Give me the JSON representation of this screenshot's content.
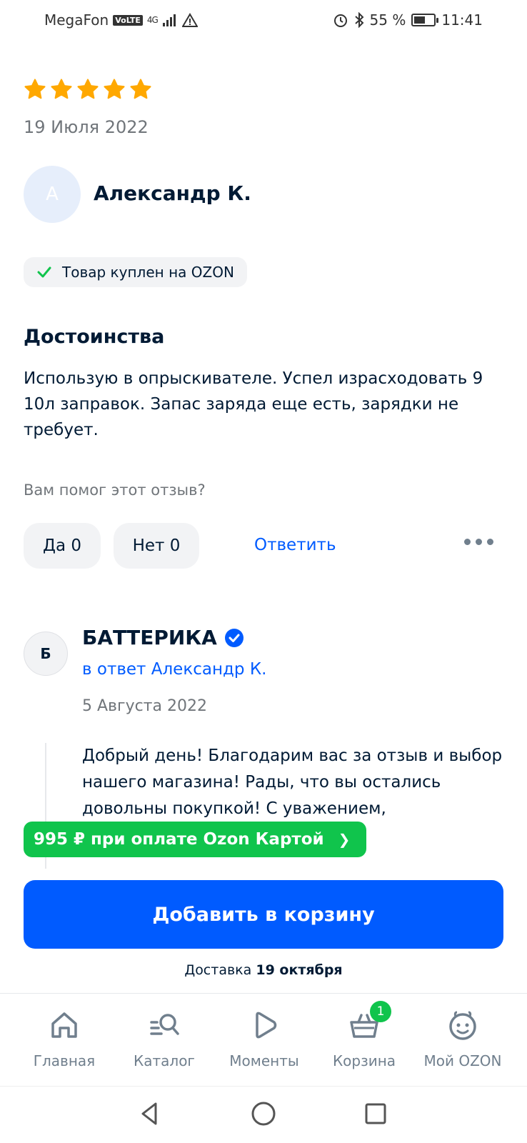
{
  "status_bar": {
    "carrier": "MegaFon",
    "volte": "VoLTE",
    "network": "4G",
    "battery": "55 %",
    "battery_level": 0.55,
    "time": "11:41"
  },
  "review": {
    "rating": 5,
    "date": "19 Июля 2022",
    "author_initial": "А",
    "author": "Александр К.",
    "verified_chip": "Товар куплен на OZON",
    "section_title": "Достоинства",
    "section_text": "Использую в опрыскивателе. Успел израсходовать 9 10л заправок. Запас заряда еще есть, зарядки не требует.",
    "helpful_question": "Вам помог этот отзыв?",
    "yes_label": "Да 0",
    "no_label": "Нет 0",
    "reply_label": "Ответить"
  },
  "seller_reply": {
    "initial": "Б",
    "name": "БАТТЕРИКА",
    "in_reply_to": "в ответ Александр К.",
    "date": "5 Августа 2022",
    "text": "Добрый день! Благодарим вас за отзыв и выбор нашего магазина! Рады, что вы остались довольны покупкой! С уважением,"
  },
  "purchase": {
    "promo": "995 ₽ при оплате Ozon Картой",
    "add_to_cart": "Добавить в корзину",
    "delivery_prefix": "Доставка",
    "delivery_date": "19 октября"
  },
  "tabs": [
    {
      "label": "Главная",
      "icon": "home-icon"
    },
    {
      "label": "Каталог",
      "icon": "catalog-icon"
    },
    {
      "label": "Моменты",
      "icon": "moments-icon"
    },
    {
      "label": "Корзина",
      "icon": "cart-icon",
      "badge": "1"
    },
    {
      "label": "Мой OZON",
      "icon": "profile-icon"
    }
  ],
  "colors": {
    "accent": "#005bff",
    "star": "#ffa800",
    "green": "#10c44c",
    "text": "#001a34",
    "muted": "#70757a"
  }
}
